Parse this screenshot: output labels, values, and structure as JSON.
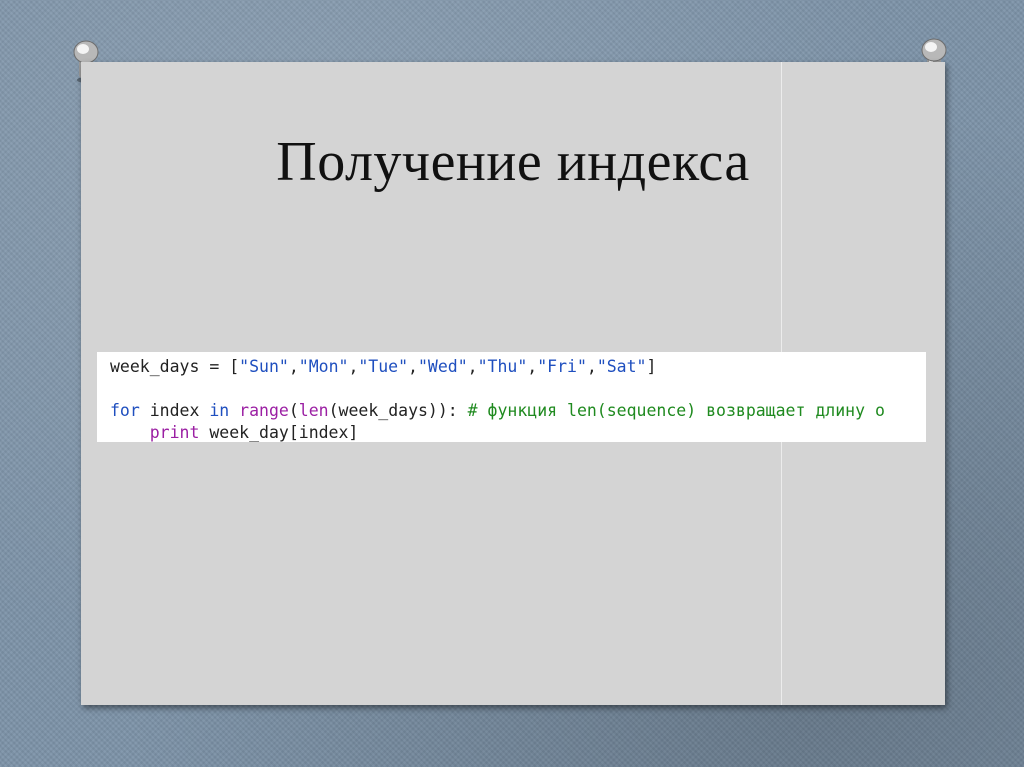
{
  "slide": {
    "title": "Получение индекса"
  },
  "code": {
    "line1": {
      "var": "week_days",
      "assign": " = [",
      "items": [
        "\"Sun\"",
        "\"Mon\"",
        "\"Tue\"",
        "\"Wed\"",
        "\"Thu\"",
        "\"Fri\"",
        "\"Sat\""
      ],
      "sep": ",",
      "close": "]"
    },
    "line3": {
      "kw_for": "for",
      "var": " index ",
      "kw_in": "in",
      "sp": " ",
      "fn_range": "range",
      "paren1": "(",
      "fn_len": "len",
      "args": "(week_days)): ",
      "comment": "# функция len(sequence) возвращает длину о"
    },
    "line4": {
      "indent": "    ",
      "kw_print": "print",
      "rest": " week_day[index]"
    }
  },
  "colors": {
    "slide": "#d4d4d4",
    "background": "#7d93a8",
    "keyword": "#1f4fbf",
    "builtin": "#9b1fa3",
    "comment": "#1f8a1f"
  },
  "icons": [
    "pushpin-icon",
    "pushpin-icon"
  ]
}
